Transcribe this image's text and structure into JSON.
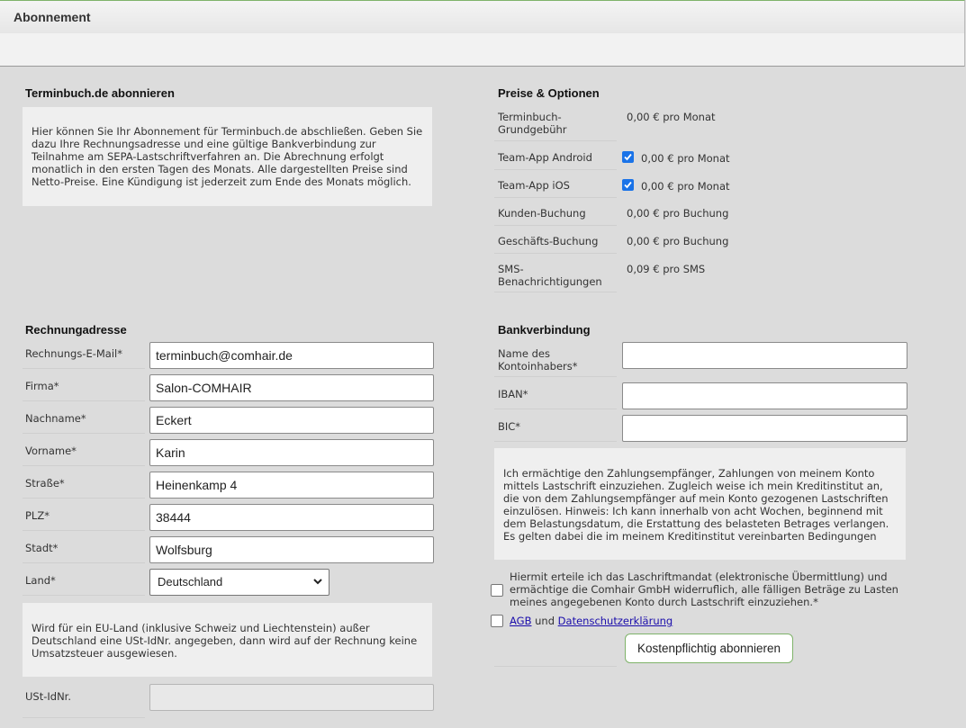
{
  "window": {
    "title": "Abonnement"
  },
  "subscribe": {
    "title": "Terminbuch.de abonnieren",
    "info": "Hier können Sie Ihr Abonnement für Terminbuch.de abschließen. Geben Sie dazu Ihre Rechnungsadresse und eine gültige Bankverbindung zur Teilnahme am SEPA-Lastschriftverfahren an. Die Abrechnung erfolgt monatlich in den ersten Tagen des Monats. Alle dargestellten Preise sind Netto-Preise. Eine Kündigung ist jederzeit zum Ende des Monats möglich."
  },
  "prices": {
    "title": "Preise & Optionen",
    "items": [
      {
        "label": "Terminbuch-Grundgebühr",
        "value": "0,00 € pro Monat",
        "checkbox": false
      },
      {
        "label": "Team-App Android",
        "value": "0,00 € pro Monat",
        "checkbox": true,
        "checked": true
      },
      {
        "label": "Team-App iOS",
        "value": "0,00 € pro Monat",
        "checkbox": true,
        "checked": true
      },
      {
        "label": "Kunden-Buchung",
        "value": "0,00 € pro Buchung",
        "checkbox": false
      },
      {
        "label": "Geschäfts-Buchung",
        "value": "0,00 € pro Buchung",
        "checkbox": false
      },
      {
        "label": "SMS-Benachrichtigungen",
        "value": "0,09 € pro SMS",
        "checkbox": false
      }
    ]
  },
  "billing": {
    "title": "Rechnungadresse",
    "fields": [
      {
        "label": "Rechnungs-E-Mail*",
        "value": "terminbuch@comhair.de"
      },
      {
        "label": "Firma*",
        "value": "Salon-COMHAIR"
      },
      {
        "label": "Nachname*",
        "value": "Eckert"
      },
      {
        "label": "Vorname*",
        "value": "Karin"
      },
      {
        "label": "Straße*",
        "value": "Heinenkamp 4"
      },
      {
        "label": "PLZ*",
        "value": "38444"
      },
      {
        "label": "Stadt*",
        "value": "Wolfsburg"
      }
    ],
    "country_label": "Land*",
    "country_value": "Deutschland",
    "vat_info": "Wird für ein EU-Land (inklusive Schweiz und Liechtenstein) außer Deutschland eine USt-IdNr. angegeben, dann wird auf der Rechnung keine Umsatzsteuer ausgewiesen.",
    "vat_label": "USt-IdNr.",
    "vat_value": ""
  },
  "bank": {
    "title": "Bankverbindung",
    "fields": [
      {
        "label": "Name des Kontoinhabers*",
        "value": ""
      },
      {
        "label": "IBAN*",
        "value": ""
      },
      {
        "label": "BIC*",
        "value": ""
      }
    ],
    "mandate_info": "Ich ermächtige den Zahlungsempfänger, Zahlungen von meinem Konto mittels Lastschrift einzuziehen. Zugleich weise ich mein Kreditinstitut an, die von dem Zahlungsempfänger auf mein Konto gezogenen Lastschriften einzulösen. Hinweis: Ich kann innerhalb von acht Wochen, beginnend mit dem Belastungsdatum, die Erstattung des belasteten Betrages verlangen. Es gelten dabei die im meinem Kreditinstitut vereinbarten Bedingungen",
    "mandate_checkbox_label": "Hiermit erteile ich das Laschriftmandat (elektronische Übermittlung) und ermächtige die Comhair GmbH widerruflich, alle fälligen Beträge zu Lasten meines angegebenen Konto durch Lastschrift einzuziehen.*",
    "agb_link": "AGB",
    "and_text": "und",
    "privacy_link": "Datenschutzerklärung",
    "submit_label": "Kostenpflichtig abonnieren"
  },
  "colors": {
    "accent": "#7fb36a",
    "checkbox": "#1a73e8",
    "link": "#1a0dab"
  }
}
